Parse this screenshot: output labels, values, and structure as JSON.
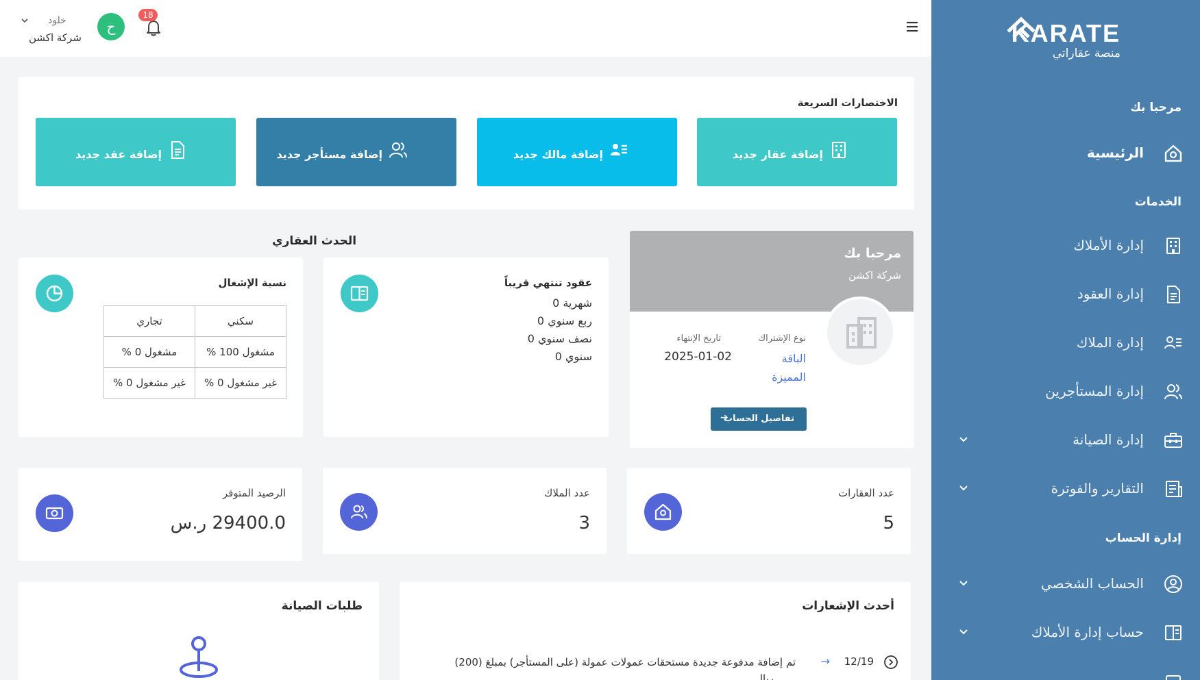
{
  "brand": {
    "name": "KARATE",
    "tagline": "منصة عقاراتي"
  },
  "sidebar": {
    "welcome_heading": "مرحبا بك",
    "home_label": "الرئيسية",
    "services_heading": "الخدمات",
    "items": [
      {
        "label": "إدارة الأملاك",
        "icon": "building-icon"
      },
      {
        "label": "إدارة العقود",
        "icon": "document-icon"
      },
      {
        "label": "إدارة الملاك",
        "icon": "owner-list-icon"
      },
      {
        "label": "إدارة المستأجرين",
        "icon": "users-icon"
      },
      {
        "label": "إدارة الصيانة",
        "icon": "toolbox-icon"
      },
      {
        "label": "التقارير والفوترة",
        "icon": "report-icon"
      }
    ],
    "account_heading": "إدارة الحساب",
    "account_items": [
      {
        "label": "الحساب الشخصي",
        "icon": "user-circle-icon"
      },
      {
        "label": "حساب إدارة الأملاك",
        "icon": "book-open-icon"
      }
    ]
  },
  "topbar": {
    "notification_count": "18",
    "avatar_initial": "ح",
    "user_name": "خلود",
    "company": "شركة اكشن"
  },
  "shortcuts": {
    "title": "الاختصارات السريعة",
    "buttons": [
      {
        "label": "إضافة عقار جديد",
        "icon": "building-icon",
        "color": "#3ec9c8"
      },
      {
        "label": "إضافة مالك جديد",
        "icon": "owner-list-icon",
        "color": "#09bdeb"
      },
      {
        "label": "إضافة مستأجر جديد",
        "icon": "users-icon",
        "color": "#337fa8"
      },
      {
        "label": "إضافة عقد جديد",
        "icon": "document-icon",
        "color": "#3ec9c8"
      }
    ]
  },
  "welcome_card": {
    "title": "مرحبا بك",
    "company": "شركة اكشن",
    "subscription_label": "نوع الإشتراك",
    "subscription_value_line1": "الباقة",
    "subscription_value_line2": "المميزة",
    "expiry_label": "تاريخ الإنتهاء",
    "expiry_value": "2025-01-02",
    "details_button": "تفاصيل الحساب",
    "details_arrow": "➔"
  },
  "events": {
    "title": "الحدث العقاري",
    "expiring": {
      "title": "عقود تنتهي قريباً",
      "lines": [
        "شهرية 0",
        "ربع سنوي 0",
        "نصف سنوي 0",
        "سنوي 0"
      ]
    },
    "occupancy": {
      "title": "نسبة الإشغال",
      "headers": [
        "سكني",
        "تجاري"
      ],
      "rows": [
        [
          "مشغول 100 %",
          "مشغول 0 %"
        ],
        [
          "غير مشغول 0 %",
          "غير مشغول 0 %"
        ]
      ]
    }
  },
  "stats": [
    {
      "label": "عدد العقارات",
      "value": "5"
    },
    {
      "label": "عدد الملاك",
      "value": "3"
    },
    {
      "label": "الرصيد المتوفر",
      "value": "29400.0 ر.س"
    }
  ],
  "notifications": {
    "title": "أحدث الإشعارات",
    "items": [
      {
        "date": "12/19",
        "text": "تم إضافة مدفوعة جديدة مستحقات عمولات عمولة (على المستأجر) بمبلغ (200)",
        "text_cont": "ريال"
      }
    ]
  },
  "maintenance": {
    "title": "طلبات الصيانة"
  },
  "colors": {
    "sidebar": "#4a7fae",
    "teal": "#3ec9c8",
    "cyan": "#09bdeb",
    "steel_blue": "#337fa8",
    "indigo": "#5465d8",
    "badge": "#f25c5c",
    "avatar": "#2dbf7e"
  }
}
